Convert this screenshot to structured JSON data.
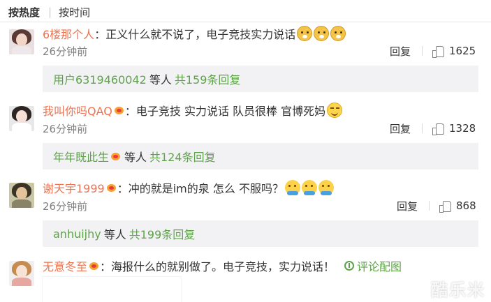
{
  "sort": {
    "hot": "按热度",
    "time": "按时间"
  },
  "comments": [
    {
      "user": "6楼那个人",
      "text": "：正义什么就不说了，电子竞技实力说话",
      "time": "26分钟前",
      "reply_label": "回复",
      "likes": "1625",
      "emojis": [
        "dog-emoji",
        "dog-emoji",
        "dog-emoji"
      ],
      "sub": {
        "user": "用户6319460042",
        "mid": "等人",
        "count": "共159条回复"
      }
    },
    {
      "user": "我叫你吗QAQ",
      "text": "：电子竞技 实力说话 队员很棒 官博死妈",
      "time": "26分钟前",
      "reply_label": "回复",
      "likes": "1328",
      "emojis": [
        "smile-emoji"
      ],
      "sub": {
        "user": "年年既此生",
        "mid": "等人",
        "count": "共124条回复"
      }
    },
    {
      "user": "谢天宇1999",
      "text": "：冲的就是im的泉 怎么 不服吗？",
      "time": "26分钟前",
      "reply_label": "回复",
      "likes": "868",
      "emojis": [
        "pray-emoji",
        "pray-emoji",
        "pray-emoji"
      ],
      "sub": {
        "user": "anhuijhy",
        "mid": "等人",
        "count": "共199条回复"
      }
    },
    {
      "user": "无意冬至",
      "text": "：海报什么的就别做了。电子竞技，实力说话！",
      "pic_link": "评论配图"
    }
  ],
  "watermark": "酷乐米",
  "colors": {
    "username": "#eb7350",
    "link_green": "#5fa24a",
    "reply_bg": "#f2f2f5"
  }
}
